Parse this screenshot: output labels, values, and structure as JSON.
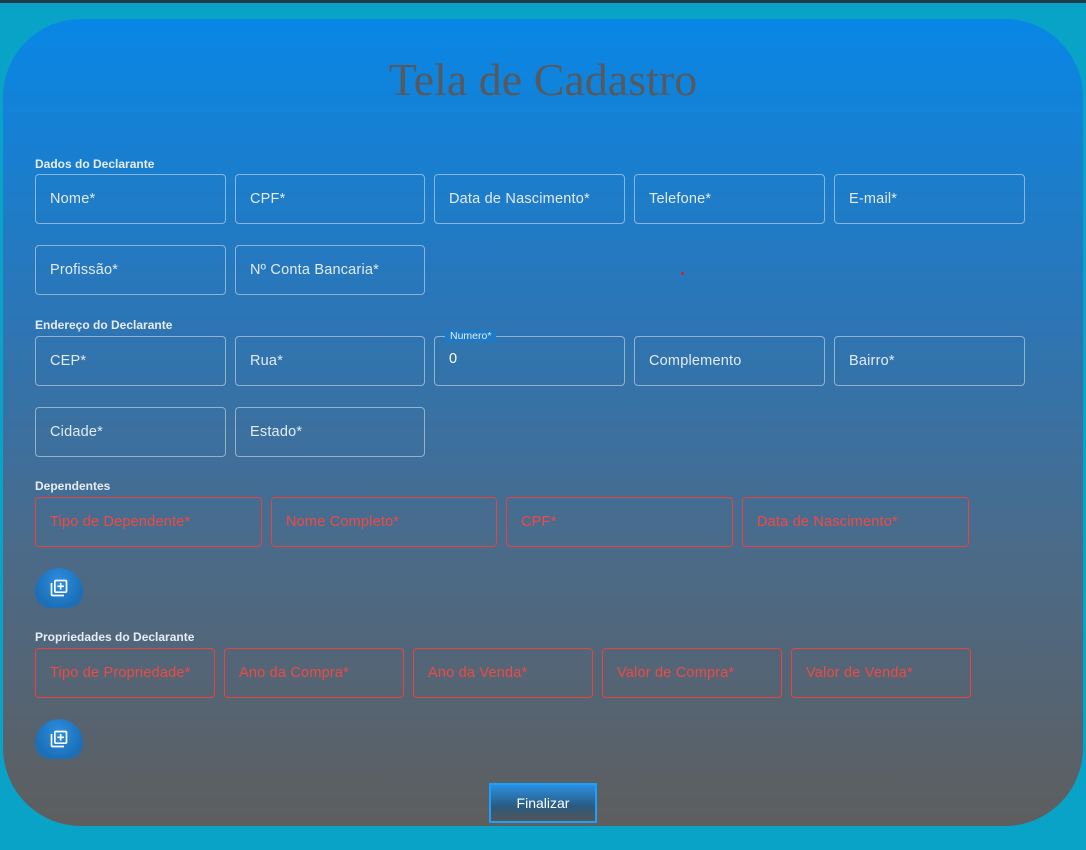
{
  "title": "Tela de Cadastro",
  "sections": {
    "dados": "Dados do Declarante",
    "endereco": "Endereço do Declarante",
    "dependentes": "Dependentes",
    "propriedades": "Propriedades do Declarante"
  },
  "dados_fields": {
    "nome": "Nome*",
    "cpf": "CPF*",
    "nascimento": "Data de Nascimento*",
    "telefone": "Telefone*",
    "email": "E-mail*",
    "profissao": "Profissão*",
    "conta": "Nº Conta Bancaria*"
  },
  "endereco_fields": {
    "cep": "CEP*",
    "rua": "Rua*",
    "numero_label": "Numero*",
    "numero_value": "0",
    "complemento": "Complemento",
    "bairro": "Bairro*",
    "cidade": "Cidade*",
    "estado": "Estado*"
  },
  "dependentes_fields": {
    "tipo": "Tipo de Dependente*",
    "nome": "Nome Completo*",
    "cpf": "CPF*",
    "nascimento": "Data de Nascimento*"
  },
  "propriedades_fields": {
    "tipo": "Tipo de Propriedade*",
    "ano_compra": "Ano da Compra*",
    "ano_venda": "Ano da Venda*",
    "valor_compra": "Valor de Compra*",
    "valor_venda": "Valor de Venda*"
  },
  "buttons": {
    "finalizar": "Finalizar",
    "add_icon": "library-add-icon"
  },
  "colors": {
    "page_bg": "#0aa3c8",
    "card_top": "#0887e6",
    "card_bottom": "#5e5e5e",
    "error": "#e8433f",
    "title": "#555a60"
  }
}
